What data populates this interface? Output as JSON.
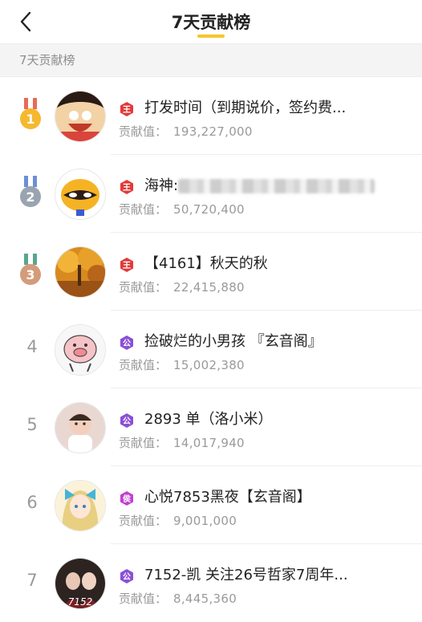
{
  "header": {
    "title": "7天贡献榜"
  },
  "section": {
    "label": "7天贡献榜"
  },
  "contribution_label": "贡献值：",
  "rows": [
    {
      "rank": "1",
      "badge": "王",
      "badge_color": "#e23a3a",
      "name": "打发时间（到期说价，签约费...",
      "value": "193,227,000"
    },
    {
      "rank": "2",
      "badge": "王",
      "badge_color": "#e23a3a",
      "name": "海神:",
      "value": "50,720,400"
    },
    {
      "rank": "3",
      "badge": "王",
      "badge_color": "#e23a3a",
      "name": "【4161】秋天的秋",
      "value": "22,415,880"
    },
    {
      "rank": "4",
      "badge": "公",
      "badge_color": "#8a4fd6",
      "name": "捡破烂的小男孩 『玄音阁』",
      "value": "15,002,380"
    },
    {
      "rank": "5",
      "badge": "公",
      "badge_color": "#8a4fd6",
      "name": "2893 单（洛小米）",
      "value": "14,017,940"
    },
    {
      "rank": "6",
      "badge": "侯",
      "badge_color": "#c23fd0",
      "name": "心悦7853黑夜【玄音阁】",
      "value": "9,001,000"
    },
    {
      "rank": "7",
      "badge": "公",
      "badge_color": "#8a4fd6",
      "name": "7152-凯  关注26号哲家7周年...",
      "value": "8,445,360"
    }
  ],
  "medal_colors": {
    "gold": "#f5b82e",
    "silver": "#9aa4b1",
    "bronze": "#d39c7a"
  }
}
